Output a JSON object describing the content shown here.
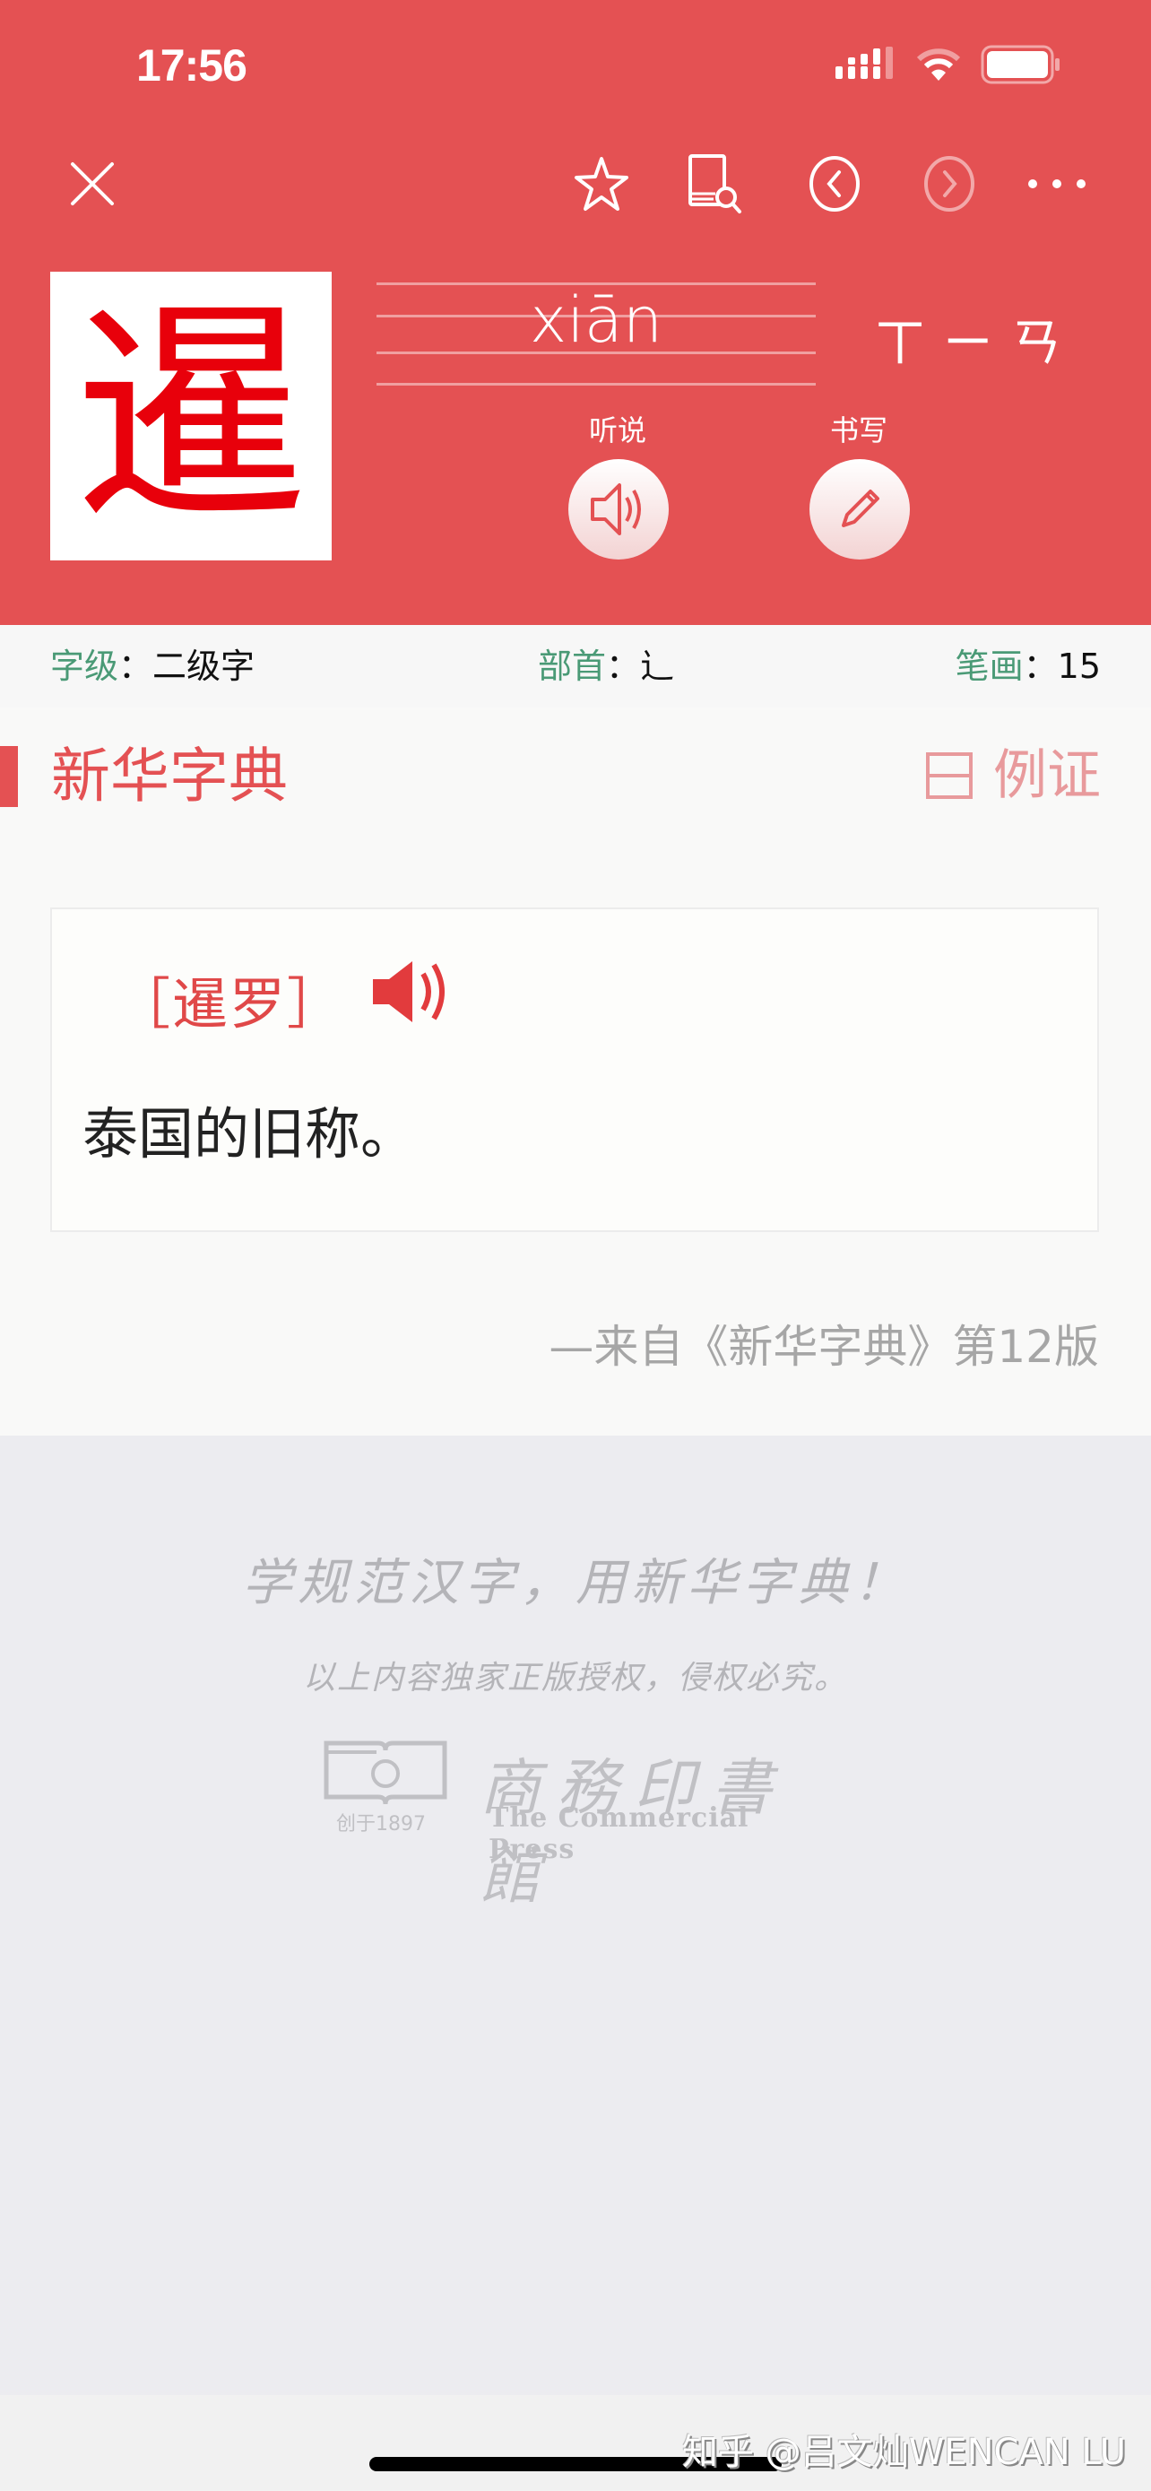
{
  "status_bar": {
    "time": "17:56"
  },
  "nav": {
    "close": "close-icon",
    "favorite": "star-icon",
    "lookup": "book-search-icon",
    "previous": "chevron-left-circle-icon",
    "next": "chevron-right-circle-icon",
    "more": "more-icon"
  },
  "character": {
    "glyph": "暹",
    "pinyin": "xiān",
    "zhuyin": "ㄒㄧㄢ"
  },
  "actions": {
    "listen_label": "听说",
    "write_label": "书写"
  },
  "info": {
    "level_label": "字级",
    "level_value": "二级字",
    "radical_label": "部首",
    "radical_value": "辶",
    "strokes_label": "笔画",
    "strokes_value": "15",
    "separator": "："
  },
  "section": {
    "title": "新华字典",
    "example_label": "例证"
  },
  "entry": {
    "word": "［暹罗］",
    "definition": "泰国的旧称。"
  },
  "source": "—来自《新华字典》第12版",
  "footer": {
    "slogan": "学规范汉字，用新华字典！",
    "copyright": "以上内容独家正版授权，侵权必究。",
    "publisher_cn": "商務印書館",
    "publisher_en": "The Commercial Press",
    "founded": "创于1897"
  },
  "watermark": "知乎 @吕文灿WENCAN LU",
  "colors": {
    "brand_red": "#e45153",
    "label_green": "#4a9a76",
    "glyph_red": "#e8000b"
  }
}
